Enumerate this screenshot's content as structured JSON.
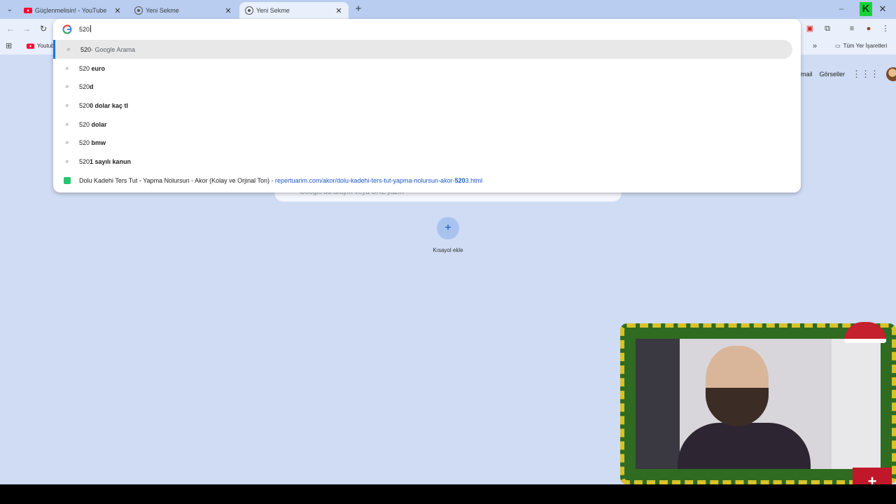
{
  "tabs": [
    {
      "title": "Güçlenmelisin! - YouTube",
      "favicon": "youtube-icon",
      "active": false
    },
    {
      "title": "Yeni Sekme",
      "favicon": "chrome-icon",
      "active": false
    },
    {
      "title": "Yeni Sekme",
      "favicon": "chrome-icon",
      "active": true
    }
  ],
  "omnibox": {
    "input_value": "520",
    "suggestions": [
      {
        "typed": "520",
        "completion": "",
        "description": " - Google Arama",
        "type": "search",
        "selected": true
      },
      {
        "typed": "520",
        "completion": " euro",
        "description": "",
        "type": "search",
        "selected": false
      },
      {
        "typed": "520",
        "completion": "d",
        "description": "",
        "type": "search",
        "selected": false
      },
      {
        "typed": "520",
        "completion": "0 dolar kaç tl",
        "description": "",
        "type": "search",
        "selected": false
      },
      {
        "typed": "520",
        "completion": " dolar",
        "description": "",
        "type": "search",
        "selected": false
      },
      {
        "typed": "520",
        "completion": " bmw",
        "description": "",
        "type": "search",
        "selected": false
      },
      {
        "typed": "520",
        "completion": "1 sayılı kanun",
        "description": "",
        "type": "search",
        "selected": false
      }
    ],
    "site_suggestion": {
      "title": "Dolu Kadehi Ters Tut - Yapma Nolursun - Akor (Kolay ve Orjinal Ton)",
      "separator": " - ",
      "url_prefix": "repertuarim.com/akor/dolu-kadehi-ters-tut-yapma-nolursun-akor-",
      "url_match": "520",
      "url_suffix": "3.html"
    }
  },
  "bookmarks": {
    "youtube_label": "Youtub",
    "all_bookmarks_label": "Tüm Yer İşaretleri"
  },
  "ntp": {
    "gmail_label": "mail",
    "images_label": "Görseller",
    "search_placeholder": "Google'da arayın veya URL yazın",
    "add_shortcut_label": "Kısayol ekle"
  },
  "colors": {
    "accent": "#1a73e8",
    "page_bg": "#cfdcf3",
    "url_link": "#1a57c6"
  }
}
